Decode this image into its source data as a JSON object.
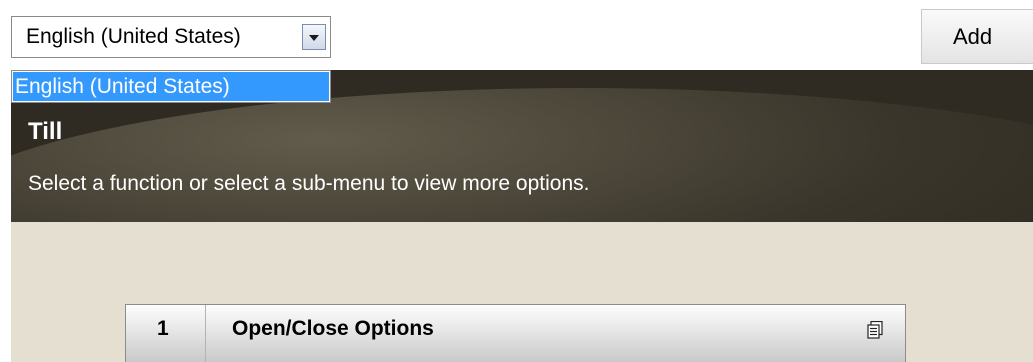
{
  "language": {
    "selected": "English (United States)",
    "options": [
      "English (United States)"
    ]
  },
  "toolbar": {
    "add_label": "Add"
  },
  "header": {
    "title": "Till",
    "subtitle": "Select a function or select a sub-menu to view more options."
  },
  "menu": {
    "items": [
      {
        "number": "1",
        "label": "Open/Close Options",
        "icon": "document-copy-icon"
      }
    ]
  },
  "colors": {
    "header_bg": "#2f2b22",
    "body_bg": "#e5dfd1",
    "selection": "#3399ff"
  }
}
